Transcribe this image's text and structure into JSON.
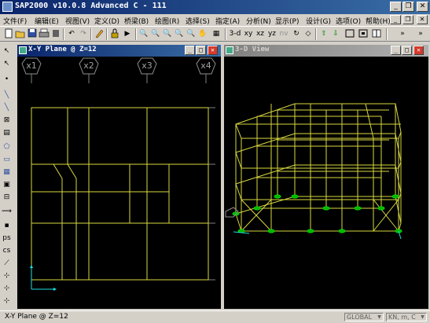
{
  "app": {
    "title": "SAP2000 v10.0.8 Advanced C  - 111"
  },
  "window_buttons": {
    "minimize": "_",
    "maximize": "❐",
    "close": "✕"
  },
  "menu": [
    {
      "label": "文件(F)"
    },
    {
      "label": "编辑(E)"
    },
    {
      "label": "视图(V)"
    },
    {
      "label": "定义(D)"
    },
    {
      "label": "桥梁(B)"
    },
    {
      "label": "绘图(R)"
    },
    {
      "label": "选择(S)"
    },
    {
      "label": "指定(A)"
    },
    {
      "label": "分析(N)"
    },
    {
      "label": "显示(P)"
    },
    {
      "label": "设计(G)"
    },
    {
      "label": "选项(O)"
    },
    {
      "label": "帮助(H)"
    }
  ],
  "toolbar": {
    "view_3d": "3-d",
    "view_xy": "xy",
    "view_xz": "xz",
    "view_yz": "yz",
    "view_nv": "nv"
  },
  "xy_window": {
    "title": "X-Y Plane @ Z=12",
    "grid_labels": [
      "x1",
      "x2",
      "x3",
      "x4"
    ]
  },
  "view3d_window": {
    "title": "3-D View"
  },
  "status": {
    "text": "X-Y Plane @ Z=12",
    "coord_system": "GLOBAL",
    "units": "KN, m, C"
  },
  "colors": {
    "frame": "#e0e040",
    "grid": "#808080",
    "support": "#00d000",
    "axis": "#20e0e0",
    "active_title": "#0a246a"
  }
}
